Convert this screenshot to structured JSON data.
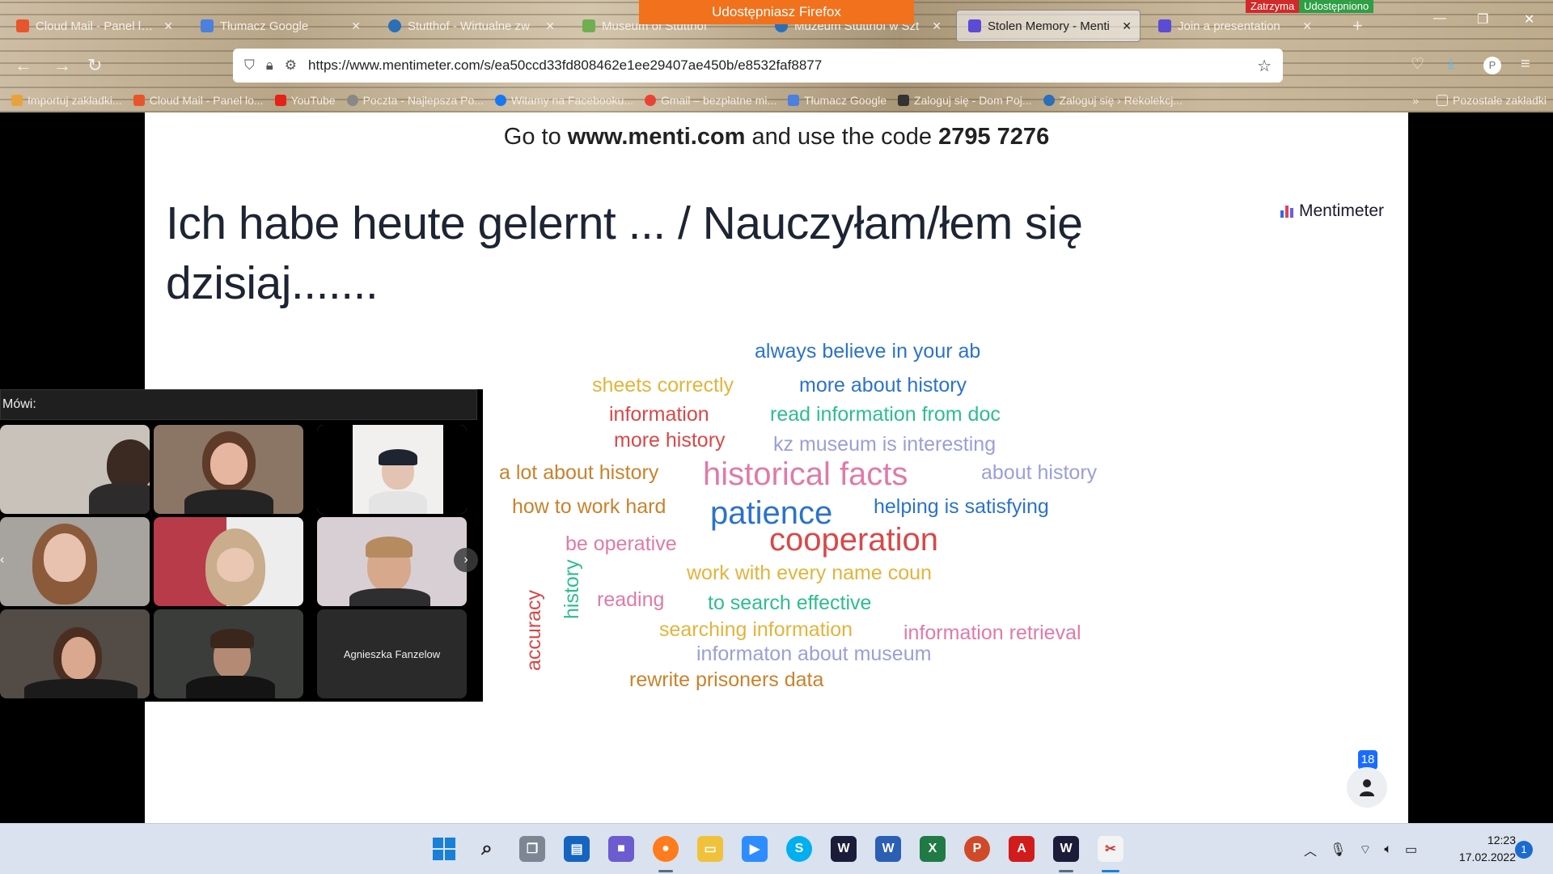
{
  "browser": {
    "sharing_banner": "Udostępniasz Firefox",
    "stop_label": "Zatrzyma",
    "shared_label": "Udostępniono",
    "tabs": [
      {
        "label": "Cloud Mail - Panel logo",
        "color": "#e8552c"
      },
      {
        "label": "Tłumacz Google",
        "color": "#4b7fe0"
      },
      {
        "label": "Stutthof - Wirtualne zw",
        "color": "#2a6fb8"
      },
      {
        "label": "Museum of Stutthof",
        "color": "#6fae51"
      },
      {
        "label": "Muzeum Stutthof w Szt",
        "color": "#2a6fb8"
      },
      {
        "label": "Stolen Memory - Menti",
        "color": "#5b4bd6"
      },
      {
        "label": "Join a presentation",
        "color": "#5b4bd6"
      }
    ],
    "url": "https://www.mentimeter.com/s/ea50ccd33fd808462e1ee29407ae450b/e8532faf8877",
    "bookmarks": [
      {
        "label": "Importuj zakładki...",
        "color": "#e9a23b"
      },
      {
        "label": "Cloud Mail - Panel lo...",
        "color": "#e8552c"
      },
      {
        "label": "YouTube",
        "color": "#e62117"
      },
      {
        "label": "Poczta - Najlepsza Po...",
        "color": "#888888"
      },
      {
        "label": "Witamy na Facebooku...",
        "color": "#1877f2"
      },
      {
        "label": "Gmail – bezpłatne mi...",
        "color": "#ea4335"
      },
      {
        "label": "Tłumacz Google",
        "color": "#4b7fe0"
      },
      {
        "label": "Zaloguj się - Dom Poj...",
        "color": "#333333"
      },
      {
        "label": "Zaloguj się › Rekolekcj...",
        "color": "#2a6fb8"
      }
    ],
    "other_bookmarks": "Pozostałe zakładki"
  },
  "slide": {
    "code_prefix": "Go to ",
    "code_site": "www.menti.com",
    "code_middle": " and use the code ",
    "code_value": "2795 7276",
    "question": "Ich habe heute gelernt ... / Nauczyłam/łem się dzisiaj.......",
    "brand": "Mentimeter",
    "participant_count": "18",
    "words": [
      {
        "text": "always believe in your ab",
        "color": "#2b73c9",
        "size": 25
      },
      {
        "text": "sheets correctly",
        "color": "#e3b43c",
        "size": 25
      },
      {
        "text": "more about history",
        "color": "#2b73c9",
        "size": 25
      },
      {
        "text": "information",
        "color": "#d94848",
        "size": 25
      },
      {
        "text": "read information from doc",
        "color": "#2ebd8f",
        "size": 25
      },
      {
        "text": "more history",
        "color": "#d94848",
        "size": 25
      },
      {
        "text": "kz museum is interesting",
        "color": "#9a9fd8",
        "size": 25
      },
      {
        "text": "a lot about history",
        "color": "#c9822c",
        "size": 25
      },
      {
        "text": "historical facts",
        "color": "#e07aa8",
        "size": 40
      },
      {
        "text": "about history",
        "color": "#9a9fd8",
        "size": 25
      },
      {
        "text": "how to work hard",
        "color": "#c9822c",
        "size": 25
      },
      {
        "text": "patience",
        "color": "#2b73c9",
        "size": 40
      },
      {
        "text": "helping is satisfying",
        "color": "#2b73c9",
        "size": 25
      },
      {
        "text": "be operative",
        "color": "#e07aa8",
        "size": 25
      },
      {
        "text": "cooperation",
        "color": "#d94848",
        "size": 40
      },
      {
        "text": "work with every name coun",
        "color": "#e3b43c",
        "size": 25
      },
      {
        "text": "accuracy",
        "color": "#d94848",
        "size": 25
      },
      {
        "text": "history",
        "color": "#2ebd8f",
        "size": 25
      },
      {
        "text": "reading",
        "color": "#e07aa8",
        "size": 25
      },
      {
        "text": "to search effective",
        "color": "#2ebd8f",
        "size": 25
      },
      {
        "text": "searching information",
        "color": "#e3b43c",
        "size": 25
      },
      {
        "text": "information retrieval",
        "color": "#e07aa8",
        "size": 25
      },
      {
        "text": "informaton about museum",
        "color": "#9a9fd8",
        "size": 25
      },
      {
        "text": "rewrite prisoners data",
        "color": "#c9822c",
        "size": 25
      }
    ]
  },
  "video_call": {
    "speaking_label": "Mówi:",
    "named_tile": "Agnieszka Fanzelow"
  },
  "taskbar": {
    "time": "12:23",
    "date": "17.02.2022",
    "notification_count": "1"
  }
}
